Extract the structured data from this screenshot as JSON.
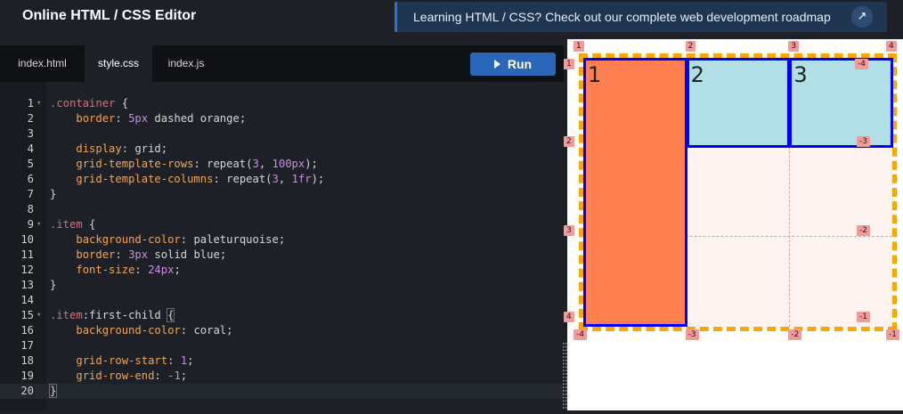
{
  "header": {
    "title": "Online HTML / CSS Editor",
    "promo_text": "Learning HTML / CSS? Check out our complete web development roadmap",
    "promo_icon": "arrow-up-right-icon"
  },
  "tabs": [
    {
      "label": "index.html"
    },
    {
      "label": "style.css"
    },
    {
      "label": "index.js"
    }
  ],
  "run_label": "Run",
  "code_lines": [
    {
      "n": "1",
      "fold": "▾",
      "html": [
        [
          "sel",
          ".container"
        ],
        [
          "pun",
          " {"
        ]
      ]
    },
    {
      "n": "2",
      "html": [
        [
          "pun",
          "    "
        ],
        [
          "prop",
          "border"
        ],
        [
          "pun",
          ": "
        ],
        [
          "num",
          "5px"
        ],
        [
          "val",
          " dashed orange"
        ],
        [
          "pun",
          ";"
        ]
      ]
    },
    {
      "n": "3",
      "html": []
    },
    {
      "n": "4",
      "html": [
        [
          "pun",
          "    "
        ],
        [
          "prop",
          "display"
        ],
        [
          "pun",
          ": "
        ],
        [
          "val",
          "grid"
        ],
        [
          "pun",
          ";"
        ]
      ]
    },
    {
      "n": "5",
      "html": [
        [
          "pun",
          "    "
        ],
        [
          "prop",
          "grid-template-rows"
        ],
        [
          "pun",
          ": "
        ],
        [
          "val",
          "repeat"
        ],
        [
          "pun",
          "("
        ],
        [
          "num",
          "3"
        ],
        [
          "pun",
          ", "
        ],
        [
          "num",
          "100px"
        ],
        [
          "pun",
          ");"
        ]
      ]
    },
    {
      "n": "6",
      "html": [
        [
          "pun",
          "    "
        ],
        [
          "prop",
          "grid-template-columns"
        ],
        [
          "pun",
          ": "
        ],
        [
          "val",
          "repeat"
        ],
        [
          "pun",
          "("
        ],
        [
          "num",
          "3"
        ],
        [
          "pun",
          ", "
        ],
        [
          "num",
          "1fr"
        ],
        [
          "pun",
          ");"
        ]
      ]
    },
    {
      "n": "7",
      "html": [
        [
          "pun",
          "}"
        ]
      ]
    },
    {
      "n": "8",
      "html": []
    },
    {
      "n": "9",
      "fold": "▾",
      "html": [
        [
          "sel",
          ".item"
        ],
        [
          "pun",
          " {"
        ]
      ]
    },
    {
      "n": "10",
      "html": [
        [
          "pun",
          "    "
        ],
        [
          "prop",
          "background-color"
        ],
        [
          "pun",
          ": "
        ],
        [
          "val",
          "paleturquoise"
        ],
        [
          "pun",
          ";"
        ]
      ]
    },
    {
      "n": "11",
      "html": [
        [
          "pun",
          "    "
        ],
        [
          "prop",
          "border"
        ],
        [
          "pun",
          ": "
        ],
        [
          "num",
          "3px"
        ],
        [
          "val",
          " solid blue"
        ],
        [
          "pun",
          ";"
        ]
      ]
    },
    {
      "n": "12",
      "html": [
        [
          "pun",
          "    "
        ],
        [
          "prop",
          "font-size"
        ],
        [
          "pun",
          ": "
        ],
        [
          "num",
          "24px"
        ],
        [
          "pun",
          ";"
        ]
      ]
    },
    {
      "n": "13",
      "html": [
        [
          "pun",
          "}"
        ]
      ]
    },
    {
      "n": "14",
      "html": []
    },
    {
      "n": "15",
      "fold": "▾",
      "html": [
        [
          "sel",
          ".item"
        ],
        [
          "pun",
          ":"
        ],
        [
          "val",
          "first-child"
        ],
        [
          "pun",
          " "
        ],
        [
          "br",
          "{"
        ]
      ]
    },
    {
      "n": "16",
      "html": [
        [
          "pun",
          "    "
        ],
        [
          "prop",
          "background-color"
        ],
        [
          "pun",
          ": "
        ],
        [
          "val",
          "coral"
        ],
        [
          "pun",
          ";"
        ]
      ]
    },
    {
      "n": "17",
      "html": []
    },
    {
      "n": "18",
      "html": [
        [
          "pun",
          "    "
        ],
        [
          "prop",
          "grid-row-start"
        ],
        [
          "pun",
          ": "
        ],
        [
          "num",
          "1"
        ],
        [
          "pun",
          ";"
        ]
      ]
    },
    {
      "n": "19",
      "html": [
        [
          "pun",
          "    "
        ],
        [
          "prop",
          "grid-row-end"
        ],
        [
          "pun",
          ": "
        ],
        [
          "op",
          "-1"
        ],
        [
          "pun",
          ";"
        ]
      ]
    },
    {
      "n": "20",
      "cur": true,
      "html": [
        [
          "br",
          "}"
        ]
      ]
    }
  ],
  "preview": {
    "items": [
      "1",
      "2",
      "3"
    ],
    "colors": {
      "coral": "#ff7f50",
      "paleturquoise": "#b0e0e6",
      "border": "#0000ff",
      "container_border": "#ffa500",
      "track": "#fdf3f1"
    },
    "top_tags": [
      "1",
      "2",
      "3",
      "4"
    ],
    "left_tags": [
      "1",
      "2",
      "3",
      "4"
    ],
    "right_tags": [
      "-4",
      "-3",
      "-2",
      "-1"
    ],
    "bottom_tags": [
      "-4",
      "-3",
      "-2",
      "-1"
    ]
  }
}
